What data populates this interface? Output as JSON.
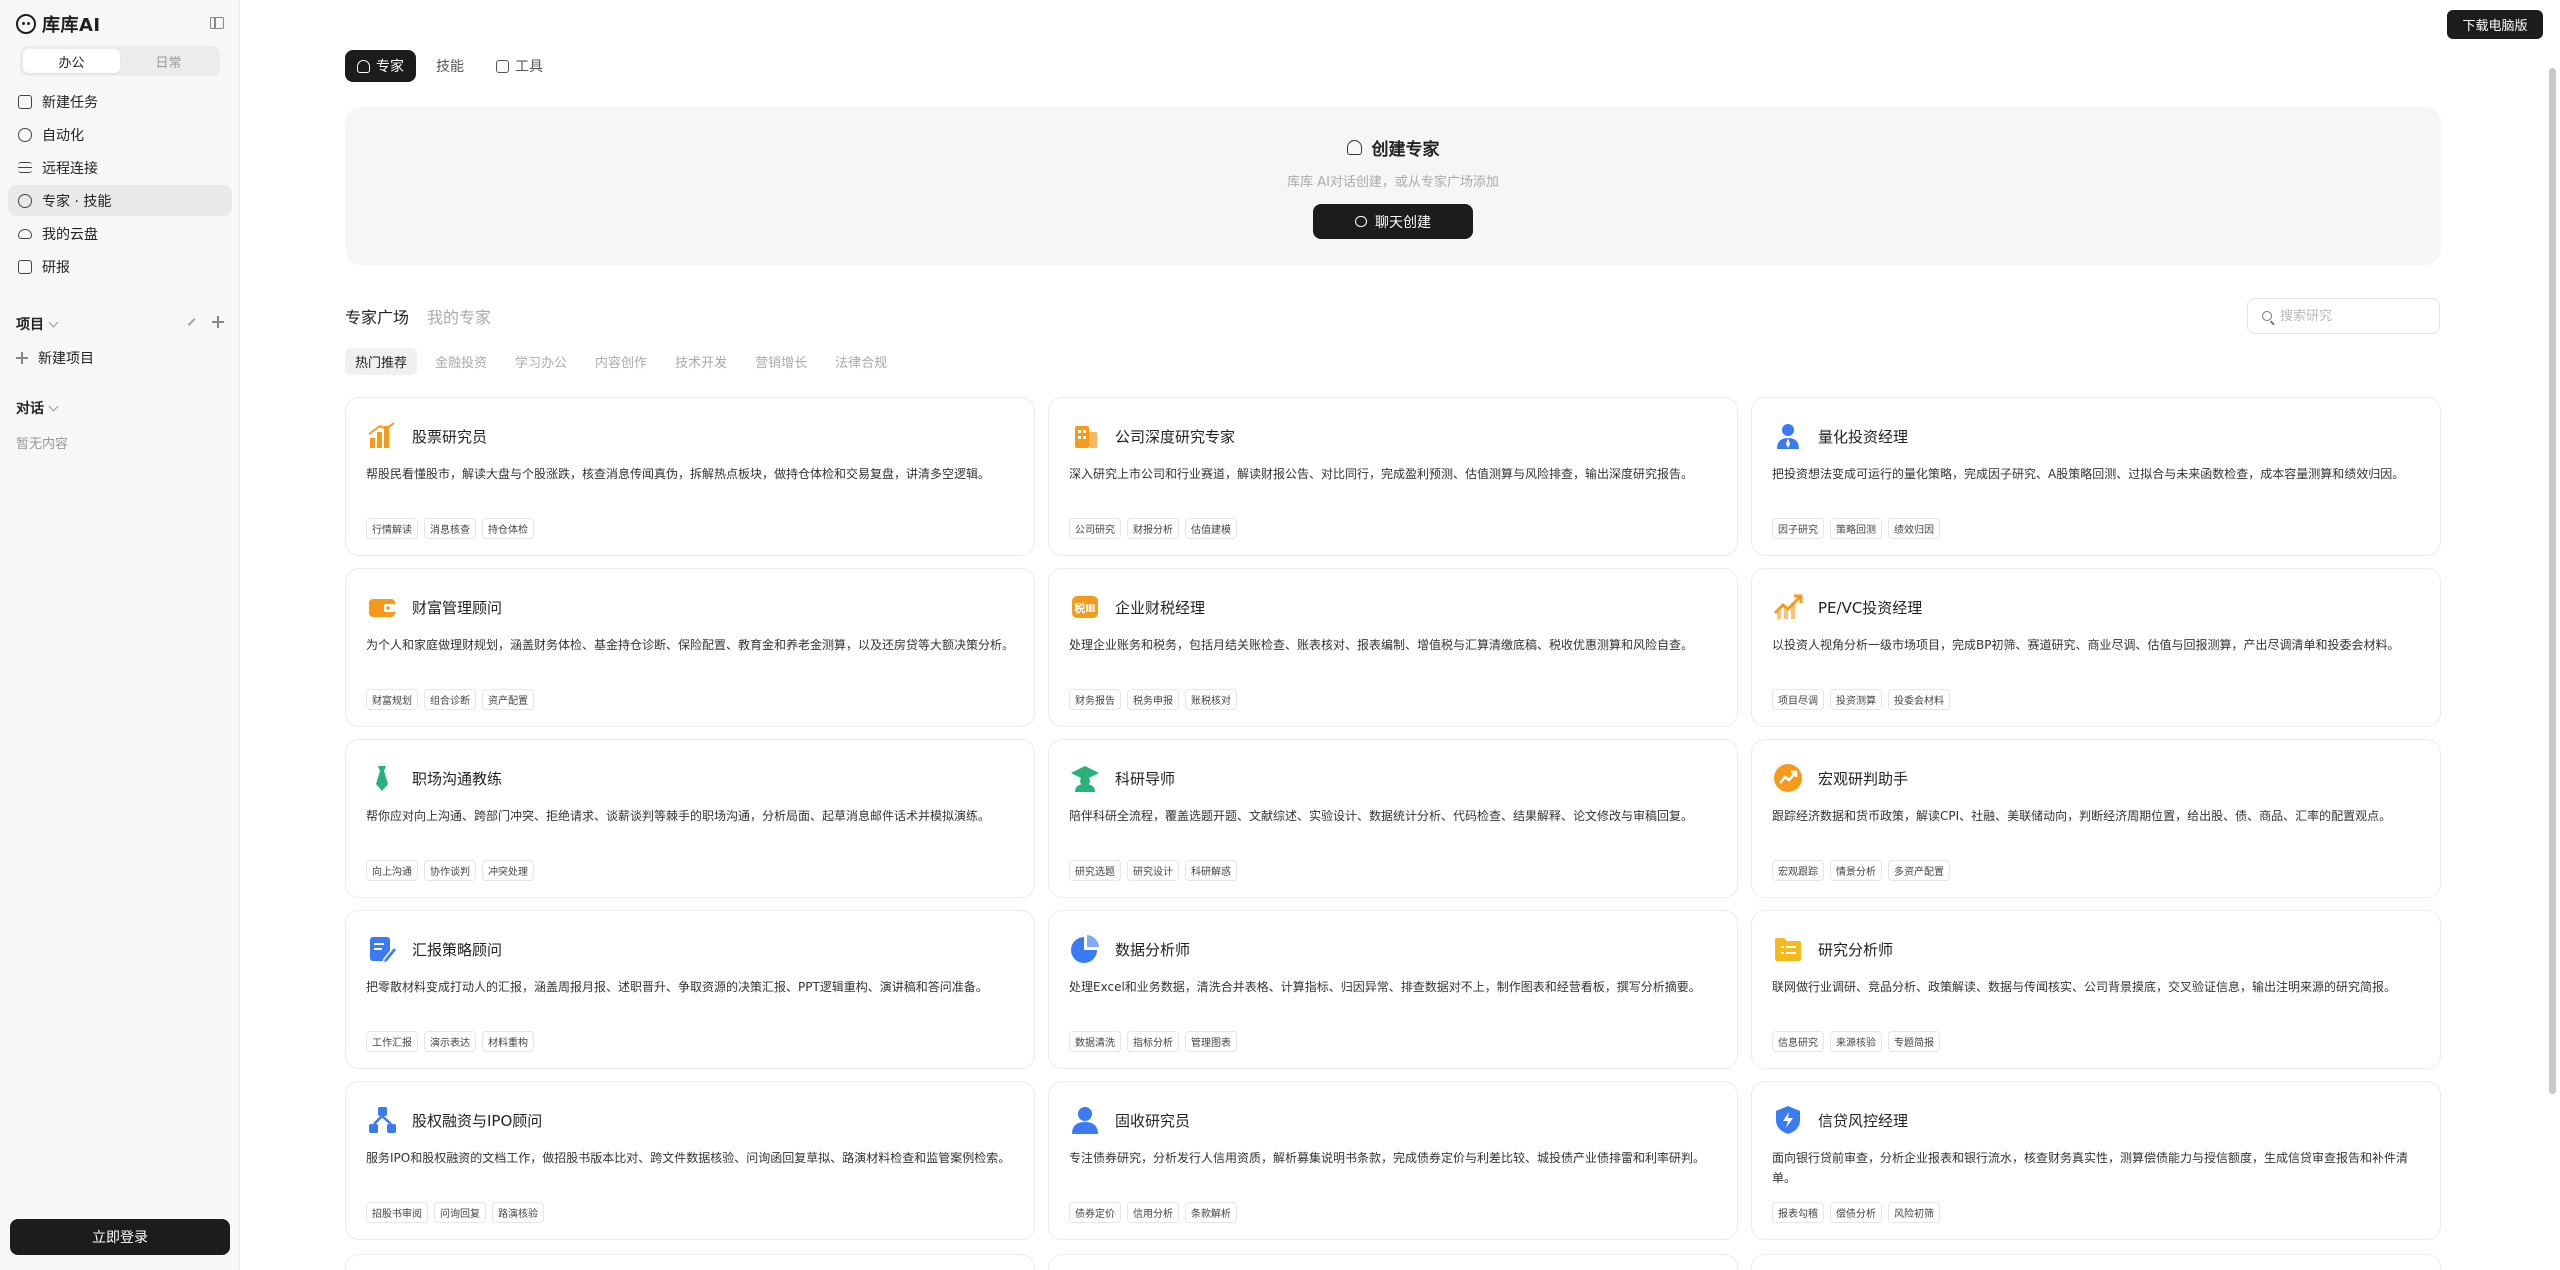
{
  "app": {
    "name": "库库AI",
    "download_label": "下载电脑版",
    "login_label": "立即登录"
  },
  "sidebar": {
    "modes": [
      "办公",
      "日常"
    ],
    "nav": [
      {
        "label": "新建任务",
        "icon": "edit-icon"
      },
      {
        "label": "自动化",
        "icon": "clock-icon"
      },
      {
        "label": "远程连接",
        "icon": "list-icon"
      },
      {
        "label": "专家 · 技能",
        "icon": "expert-icon"
      },
      {
        "label": "我的云盘",
        "icon": "cloud-icon"
      },
      {
        "label": "研报",
        "icon": "report-icon"
      }
    ],
    "projects_label": "项目",
    "new_project_label": "新建项目",
    "dialog_label": "对话",
    "empty_label": "暂无内容"
  },
  "top_tabs": [
    "专家",
    "技能",
    "工具"
  ],
  "create": {
    "title": "创建专家",
    "subtitle": "库库 AI对话创建，或从专家广场添加",
    "button": "聊天创建"
  },
  "market_tabs": [
    "专家广场",
    "我的专家"
  ],
  "search_placeholder": "搜索研究",
  "categories": [
    "热门推荐",
    "金融投资",
    "学习办公",
    "内容创作",
    "技术开发",
    "营销增长",
    "法律合规"
  ],
  "accent_colors": {
    "orange": "#f59a1c",
    "blue": "#3a7bf1",
    "green": "#27b27a",
    "dark": "#1c1c1e"
  },
  "cards": [
    {
      "title": "股票研究员",
      "icon": "bar-chart-icon",
      "color": "#f59a1c",
      "desc": "帮股民看懂股市，解读大盘与个股涨跌，核查消息传闻真伪，拆解热点板块，做持仓体检和交易复盘，讲清多空逻辑。",
      "tags": [
        "行情解读",
        "消息核查",
        "持仓体检"
      ]
    },
    {
      "title": "公司深度研究专家",
      "icon": "building-icon",
      "color": "#f59a1c",
      "desc": "深入研究上市公司和行业赛道，解读财报公告、对比同行，完成盈利预测、估值测算与风险排查，输出深度研究报告。",
      "tags": [
        "公司研究",
        "财报分析",
        "估值建模"
      ]
    },
    {
      "title": "量化投资经理",
      "icon": "manager-icon",
      "color": "#3a7bf1",
      "desc": "把投资想法变成可运行的量化策略，完成因子研究、A股策略回测、过拟合与未来函数检查，成本容量测算和绩效归因。",
      "tags": [
        "因子研究",
        "策略回测",
        "绩效归因"
      ]
    },
    {
      "title": "财富管理顾问",
      "icon": "wallet-icon",
      "color": "#f59a1c",
      "desc": "为个人和家庭做理财规划，涵盖财务体检、基金持仓诊断、保险配置、教育金和养老金测算，以及还房贷等大额决策分析。",
      "tags": [
        "财富规划",
        "组合诊断",
        "资产配置"
      ]
    },
    {
      "title": "企业财税经理",
      "icon": "tax-icon",
      "color": "#f59a1c",
      "desc": "处理企业账务和税务，包括月结关账检查、账表核对、报表编制、增值税与汇算清缴底稿、税收优惠测算和风险自查。",
      "tags": [
        "财务报告",
        "税务申报",
        "账税核对"
      ]
    },
    {
      "title": "PE/VC投资经理",
      "icon": "trend-up-icon",
      "color": "#f59a1c",
      "desc": "以投资人视角分析一级市场项目，完成BP初筛、赛道研究、商业尽调、估值与回报测算，产出尽调清单和投委会材料。",
      "tags": [
        "项目尽调",
        "投资测算",
        "投委会材料"
      ]
    },
    {
      "title": "职场沟通教练",
      "icon": "tie-icon",
      "color": "#27b27a",
      "desc": "帮你应对向上沟通、跨部门冲突、拒绝请求、谈薪谈判等棘手的职场沟通，分析局面、起草消息邮件话术并模拟演练。",
      "tags": [
        "向上沟通",
        "协作谈判",
        "冲突处理"
      ]
    },
    {
      "title": "科研导师",
      "icon": "scholar-icon",
      "color": "#27b27a",
      "desc": "陪伴科研全流程，覆盖选题开题、文献综述、实验设计、数据统计分析、代码检查、结果解释、论文修改与审稿回复。",
      "tags": [
        "研究选题",
        "研究设计",
        "科研解惑"
      ]
    },
    {
      "title": "宏观研判助手",
      "icon": "macro-trend-icon",
      "color": "#f59a1c",
      "desc": "跟踪经济数据和货币政策，解读CPI、社融、美联储动向，判断经济周期位置，给出股、债、商品、汇率的配置观点。",
      "tags": [
        "宏观跟踪",
        "情景分析",
        "多资产配置"
      ]
    },
    {
      "title": "汇报策略顾问",
      "icon": "report-edit-icon",
      "color": "#3a7bf1",
      "desc": "把零散材料变成打动人的汇报，涵盖周报月报、述职晋升、争取资源的决策汇报、PPT逻辑重构、演讲稿和答问准备。",
      "tags": [
        "工作汇报",
        "演示表达",
        "材料重构"
      ]
    },
    {
      "title": "数据分析师",
      "icon": "pie-chart-icon",
      "color": "#3a7bf1",
      "desc": "处理Excel和业务数据，清洗合并表格、计算指标、归因异常、排查数据对不上，制作图表和经营看板，撰写分析摘要。",
      "tags": [
        "数据清洗",
        "指标分析",
        "管理图表"
      ]
    },
    {
      "title": "研究分析师",
      "icon": "folder-list-icon",
      "color": "#f5b91c",
      "desc": "联网做行业调研、竞品分析、政策解读、数据与传闻核实、公司背景摸底，交叉验证信息，输出注明来源的研究简报。",
      "tags": [
        "信息研究",
        "来源核验",
        "专题简报"
      ]
    },
    {
      "title": "股权融资与IPO顾问",
      "icon": "network-icon",
      "color": "#3a7bf1",
      "desc": "服务IPO和股权融资的文档工作，做招股书版本比对、跨文件数据核验、问询函回复草拟、路演材料检查和监管案例检索。",
      "tags": [
        "招股书审阅",
        "问询回复",
        "路演核验"
      ]
    },
    {
      "title": "固收研究员",
      "icon": "person-icon",
      "color": "#3a7bf1",
      "desc": "专注债券研究，分析发行人信用资质，解析募集说明书条款，完成债券定价与利差比较、城投债产业债排雷和利率研判。",
      "tags": [
        "债券定价",
        "信用分析",
        "条款解析"
      ]
    },
    {
      "title": "信贷风控经理",
      "icon": "shield-bolt-icon",
      "color": "#3a7bf1",
      "desc": "面向银行贷前审查，分析企业报表和银行流水，核查财务真实性，测算偿债能力与授信额度，生成信贷审查报告和补件清单。",
      "tags": [
        "报表勾稽",
        "偿债分析",
        "风险初筛"
      ]
    }
  ]
}
